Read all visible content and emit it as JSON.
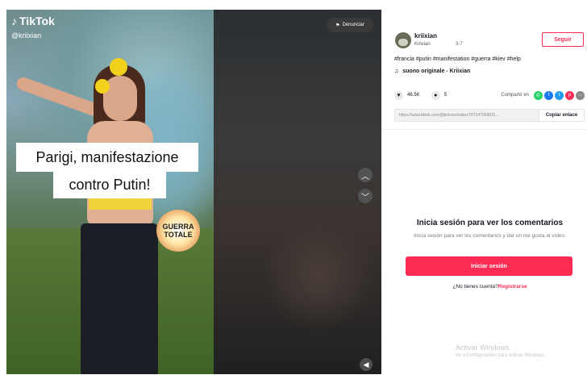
{
  "video": {
    "logo_text": "TikTok",
    "logo_icon": "music-note-icon",
    "handle": "@kriixian",
    "caption_line1": "Parigi, manifestazione",
    "caption_line2": "contro Putin!",
    "badge_line1": "GUERRA",
    "badge_line2": "TOTALE"
  },
  "controls": {
    "report_label": "Denunciar",
    "report_icon": "flag-icon",
    "up_icon": "chevron-up-icon",
    "down_icon": "chevron-down-icon",
    "volume_icon": "volume-icon"
  },
  "author": {
    "name": "kriixian",
    "nickname": "Kriixian",
    "date": "3-7"
  },
  "follow_label": "Seguir",
  "description": "#francia #putin #manifestation #guerra #kiev #help",
  "music": {
    "icon": "music-note-icon",
    "text": "suono originale - Kriixian"
  },
  "stats": {
    "likes": "46.5K",
    "comments": "5",
    "share_label": "Compartir en"
  },
  "share_targets": [
    {
      "name": "whatsapp",
      "color": "#25d366"
    },
    {
      "name": "facebook",
      "color": "#1877f2"
    },
    {
      "name": "twitter",
      "color": "#1d9bf0"
    },
    {
      "name": "pinterest",
      "color": "#fe2c55"
    },
    {
      "name": "more",
      "color": "#888888"
    }
  ],
  "link": {
    "url": "https://www.tiktok.com/@kriixian/video/707247068831...",
    "copy_label": "Copiar enlace"
  },
  "comments_gate": {
    "title": "Inicia sesión para ver los comentarios",
    "subtitle": "Inicia sesión para ver los comentarios y dar un me gusta al vídeo.",
    "login_label": "Iniciar sesión",
    "no_account": "¿No tienes cuenta?",
    "signup_label": "Registrarse"
  },
  "watermark": {
    "line1": "Activar Windows",
    "line2": "Ve a Configuración para activar Windows."
  }
}
